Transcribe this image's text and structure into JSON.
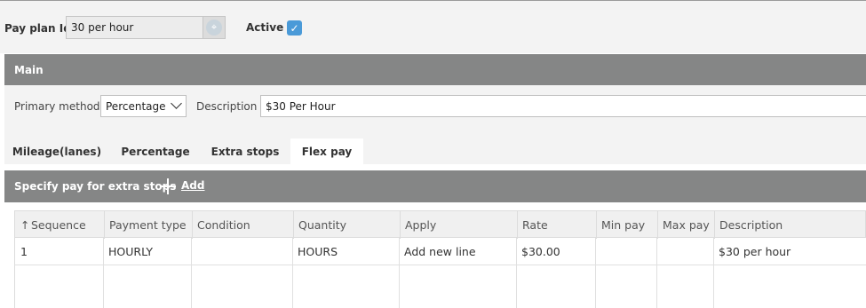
{
  "header": {
    "pay_plan_id_label": "Pay plan Id",
    "pay_plan_id_value": "30 per hour",
    "active_label": "Active",
    "active_checked": true
  },
  "main_section": {
    "title": "Main",
    "primary_method_label": "Primary method",
    "primary_method_value": "Percentage",
    "description_label": "Description",
    "description_value": "$30 Per Hour"
  },
  "tabs": [
    {
      "label": "Mileage(lanes)",
      "active": false
    },
    {
      "label": "Percentage",
      "active": false
    },
    {
      "label": "Extra stops",
      "active": false
    },
    {
      "label": "Flex pay",
      "active": true
    }
  ],
  "extra_stops": {
    "title": "Specify pay for extra stops",
    "add_label": "Add"
  },
  "table": {
    "columns": [
      "Sequence",
      "Payment type",
      "Condition",
      "Quantity",
      "Apply",
      "Rate",
      "Min pay",
      "Max pay",
      "Description"
    ],
    "rows": [
      [
        "1",
        "HOURLY",
        "",
        "HOURS",
        "Add new line",
        "$30.00",
        "",
        "",
        "$30 per hour"
      ]
    ]
  },
  "colors": {
    "section_header": "#858686",
    "checkbox": "#4a9ad8"
  }
}
